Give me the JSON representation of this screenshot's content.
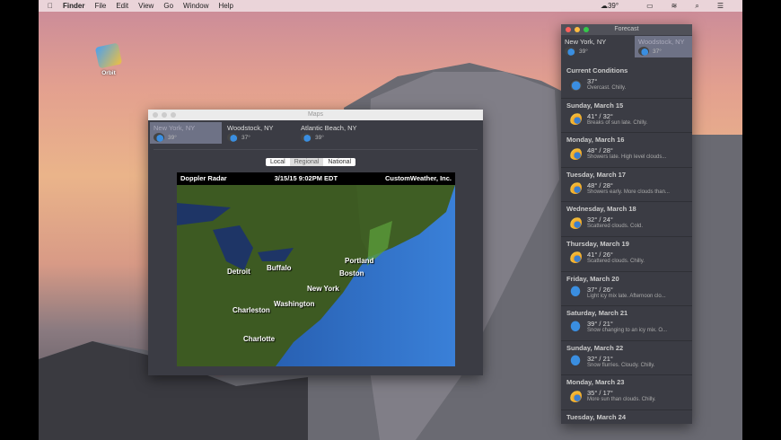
{
  "menubar": {
    "items": [
      "Finder",
      "File",
      "Edit",
      "View",
      "Go",
      "Window",
      "Help"
    ],
    "weather": "39°"
  },
  "desktop_icon": {
    "label": "Orbit"
  },
  "maps": {
    "title": "Maps",
    "locations": [
      {
        "name": "New York, NY",
        "temp": "39°"
      },
      {
        "name": "Woodstock, NY",
        "temp": "37°"
      },
      {
        "name": "Atlantic Beach, NY",
        "temp": "39°"
      }
    ],
    "tabs": [
      "Local",
      "Regional",
      "National"
    ],
    "selected_tab": "Regional",
    "radar": {
      "title": "Doppler Radar",
      "timestamp": "3/15/15 9:02PM EDT",
      "provider": "CustomWeather, Inc.",
      "cities": [
        "Detroit",
        "Buffalo",
        "Portland",
        "Boston",
        "New York",
        "Washington",
        "Charleston",
        "Charlotte"
      ]
    }
  },
  "forecast": {
    "title": "Forecast",
    "locations": [
      {
        "name": "New York, NY",
        "temp": "39°"
      },
      {
        "name": "Woodstock, NY",
        "temp": "37°"
      }
    ],
    "current": {
      "label": "Current Conditions",
      "temp": "37°",
      "desc": "Overcast. Chilly."
    },
    "days": [
      {
        "day": "Sunday, March 15",
        "temp": "41° / 32°",
        "desc": "Breaks of sun late. Chilly.",
        "icon": "sun"
      },
      {
        "day": "Monday, March 16",
        "temp": "48° / 28°",
        "desc": "Showers late. High level clouds...",
        "icon": "sun"
      },
      {
        "day": "Tuesday, March 17",
        "temp": "48° / 28°",
        "desc": "Showers early. More clouds than...",
        "icon": "sun"
      },
      {
        "day": "Wednesday, March 18",
        "temp": "32° / 24°",
        "desc": "Scattered clouds. Cold.",
        "icon": "sun"
      },
      {
        "day": "Thursday, March 19",
        "temp": "41° / 26°",
        "desc": "Scattered clouds. Chilly.",
        "icon": "sun"
      },
      {
        "day": "Friday, March 20",
        "temp": "37° / 26°",
        "desc": "Light icy mix late. Afternoon clo...",
        "icon": "snow"
      },
      {
        "day": "Saturday, March 21",
        "temp": "39° / 21°",
        "desc": "Snow changing to an icy mix. O...",
        "icon": "snow"
      },
      {
        "day": "Sunday, March 22",
        "temp": "32° / 21°",
        "desc": "Snow flurries. Cloudy. Chilly.",
        "icon": "snow"
      },
      {
        "day": "Monday, March 23",
        "temp": "35° / 17°",
        "desc": "More sun than clouds. Chilly.",
        "icon": "sun"
      },
      {
        "day": "Tuesday, March 24",
        "temp": "",
        "desc": "",
        "icon": ""
      }
    ]
  }
}
